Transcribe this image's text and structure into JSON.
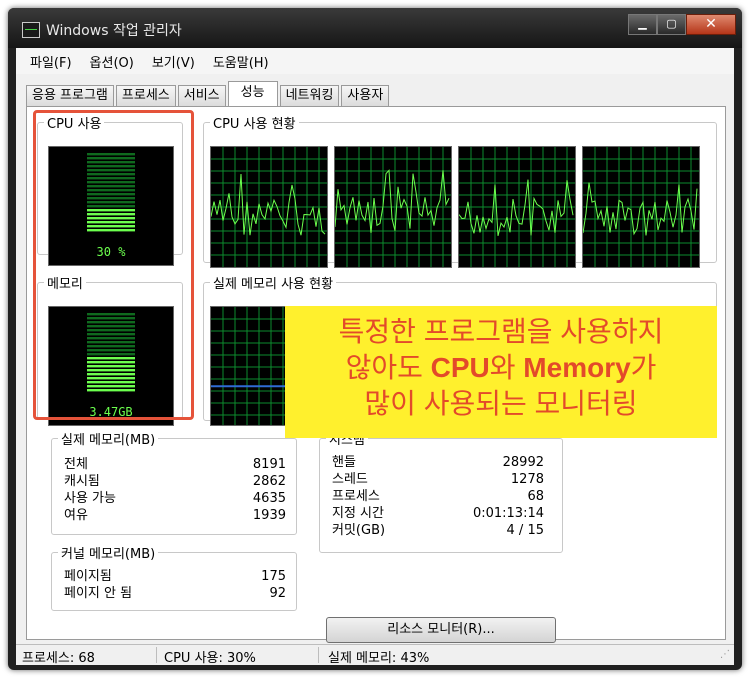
{
  "window": {
    "title": "Windows 작업 관리자",
    "minimize": "▁",
    "maximize": "▢",
    "close": "✕"
  },
  "menu": [
    "파일(F)",
    "옵션(O)",
    "보기(V)",
    "도움말(H)"
  ],
  "tabs": [
    "응용 프로그램",
    "프로세스",
    "서비스",
    "성능",
    "네트워킹",
    "사용자"
  ],
  "active_tab": "성능",
  "cpu_usage": {
    "label": "CPU 사용",
    "value": "30 %",
    "fraction": 0.3
  },
  "cpu_history": {
    "label": "CPU 사용 현황",
    "cores": 4
  },
  "memory": {
    "label": "메모리",
    "value": "3.47GB",
    "fraction": 0.43
  },
  "memory_history": {
    "label": "실제 메모리 사용 현황"
  },
  "physical_memory": {
    "label": "실제 메모리(MB)",
    "rows": [
      {
        "label": "전체",
        "value": "8191"
      },
      {
        "label": "캐시됨",
        "value": "2862"
      },
      {
        "label": "사용 가능",
        "value": "4635"
      },
      {
        "label": "여유",
        "value": "1939"
      }
    ]
  },
  "kernel_memory": {
    "label": "커널 메모리(MB)",
    "rows": [
      {
        "label": "페이지됨",
        "value": "175"
      },
      {
        "label": "페이지 안 됨",
        "value": "92"
      }
    ]
  },
  "system": {
    "label": "시스템",
    "rows": [
      {
        "label": "핸들",
        "value": "28992"
      },
      {
        "label": "스레드",
        "value": "1278"
      },
      {
        "label": "프로세스",
        "value": "68"
      },
      {
        "label": "지정 시간",
        "value": "0:01:13:14"
      },
      {
        "label": "커밋(GB)",
        "value": "4 / 15"
      }
    ]
  },
  "resource_monitor_button": "리소스 모니터(R)...",
  "status": {
    "processes": "프로세스: 68",
    "cpu": "CPU 사용: 30%",
    "memory": "실제 메모리: 43%"
  },
  "annotation": {
    "line1": "특정한 프로그램을 사용하지",
    "line2a": "않아도 ",
    "line2b": "CPU",
    "line2c": "와 ",
    "line2d": "Memory",
    "line2e": "가",
    "line3": "많이 사용되는 모니터링"
  },
  "colors": {
    "graph_green": "#6cff4e",
    "grid": "#0d8a2e",
    "mem_line": "#2f6bd6",
    "highlight": "#e5533a",
    "callout_bg": "#fff02d"
  }
}
